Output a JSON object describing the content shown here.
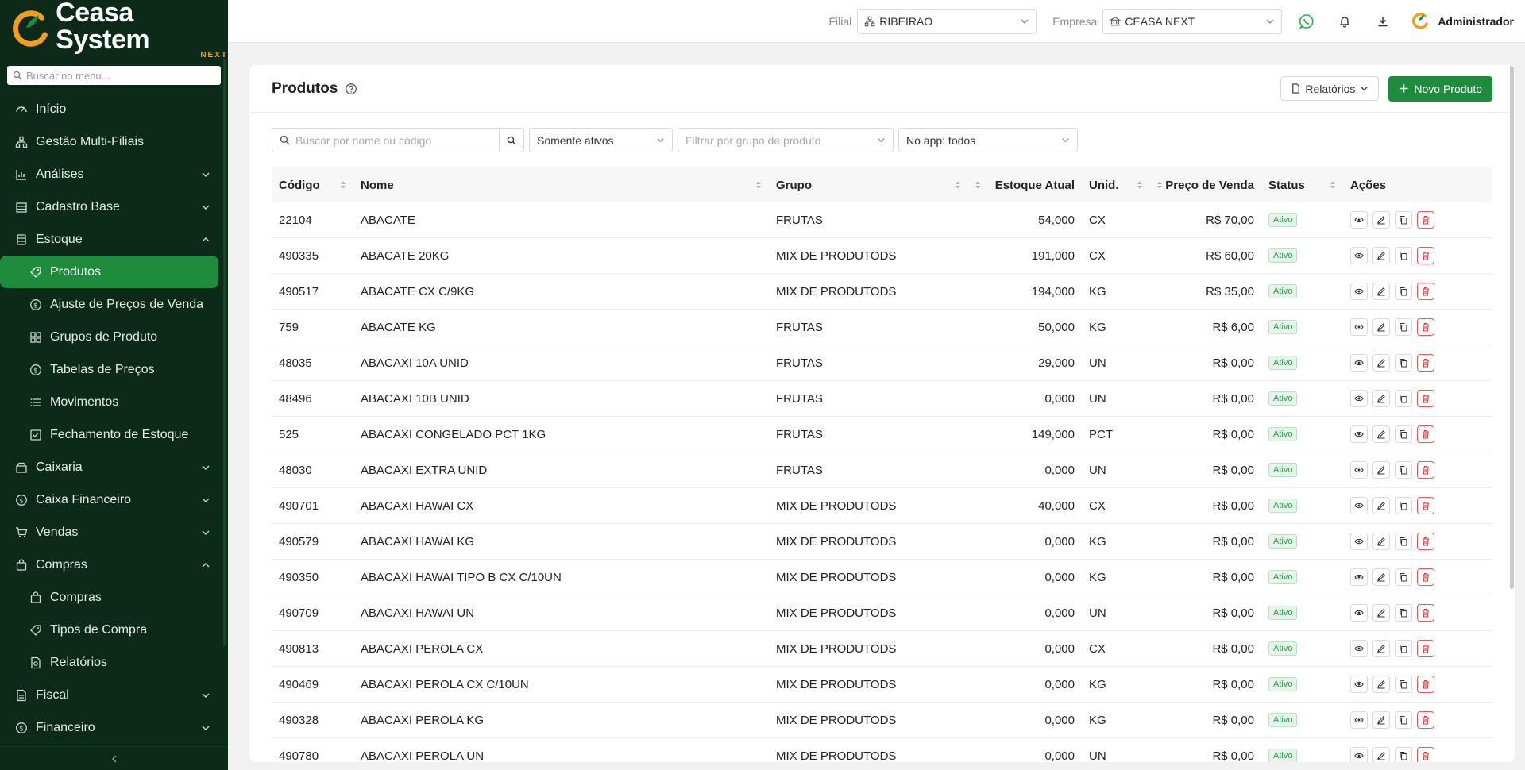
{
  "brand": {
    "name": "Ceasa System",
    "sub": "NEXT",
    "accent": "#1e8c3c",
    "orange": "#f39c1f"
  },
  "sidebar": {
    "search_placeholder": "Buscar no menu...",
    "items": [
      {
        "label": "Início",
        "icon": "dashboard-icon"
      },
      {
        "label": "Gestão Multi-Filiais",
        "icon": "network-icon"
      },
      {
        "label": "Análises",
        "icon": "chart-icon"
      },
      {
        "label": "Cadastro Base",
        "icon": "building-icon"
      },
      {
        "label": "Estoque",
        "icon": "database-icon"
      },
      {
        "label": "Produtos",
        "icon": "tag-icon"
      },
      {
        "label": "Ajuste de Preços de Venda",
        "icon": "dollar-icon"
      },
      {
        "label": "Grupos de Produto",
        "icon": "grid-icon"
      },
      {
        "label": "Tabelas de Preços",
        "icon": "dollar-icon"
      },
      {
        "label": "Movimentos",
        "icon": "list-icon"
      },
      {
        "label": "Fechamento de Estoque",
        "icon": "check-square-icon"
      },
      {
        "label": "Caixaria",
        "icon": "box-icon"
      },
      {
        "label": "Caixa Financeiro",
        "icon": "dollar-icon"
      },
      {
        "label": "Vendas",
        "icon": "cart-icon"
      },
      {
        "label": "Compras",
        "icon": "bag-icon"
      },
      {
        "label": "Compras",
        "icon": "bag-icon"
      },
      {
        "label": "Tipos de Compra",
        "icon": "tag-icon"
      },
      {
        "label": "Relatórios",
        "icon": "report-icon"
      },
      {
        "label": "Fiscal",
        "icon": "document-icon"
      },
      {
        "label": "Financeiro",
        "icon": "dollar-icon"
      }
    ]
  },
  "topbar": {
    "filial_label": "Filial",
    "filial_value": "RIBEIRAO",
    "empresa_label": "Empresa",
    "empresa_value": "CEASA NEXT",
    "user": "Administrador"
  },
  "page": {
    "title": "Produtos",
    "reports_label": "Relatórios",
    "new_label": "Novo Produto"
  },
  "filters": {
    "search_placeholder": "Buscar por nome ou código",
    "status": "Somente ativos",
    "group_placeholder": "Filtrar por grupo de produto",
    "app": "No app: todos"
  },
  "table": {
    "headers": [
      "Código",
      "Nome",
      "Grupo",
      "Estoque Atual",
      "Unid.",
      "Preço de Venda",
      "Status",
      "Ações"
    ],
    "rows": [
      [
        "22104",
        "ABACATE",
        "FRUTAS",
        "54,000",
        "CX",
        "R$ 70,00",
        "Ativo"
      ],
      [
        "490335",
        "ABACATE 20KG",
        "MIX DE PRODUTODS",
        "191,000",
        "CX",
        "R$ 60,00",
        "Ativo"
      ],
      [
        "490517",
        "ABACATE CX C/9KG",
        "MIX DE PRODUTODS",
        "194,000",
        "KG",
        "R$ 35,00",
        "Ativo"
      ],
      [
        "759",
        "ABACATE KG",
        "FRUTAS",
        "50,000",
        "KG",
        "R$ 6,00",
        "Ativo"
      ],
      [
        "48035",
        "ABACAXI 10A UNID",
        "FRUTAS",
        "29,000",
        "UN",
        "R$ 0,00",
        "Ativo"
      ],
      [
        "48496",
        "ABACAXI 10B UNID",
        "FRUTAS",
        "0,000",
        "UN",
        "R$ 0,00",
        "Ativo"
      ],
      [
        "525",
        "ABACAXI CONGELADO PCT 1KG",
        "FRUTAS",
        "149,000",
        "PCT",
        "R$ 0,00",
        "Ativo"
      ],
      [
        "48030",
        "ABACAXI EXTRA UNID",
        "FRUTAS",
        "0,000",
        "UN",
        "R$ 0,00",
        "Ativo"
      ],
      [
        "490701",
        "ABACAXI HAWAI CX",
        "MIX DE PRODUTODS",
        "40,000",
        "CX",
        "R$ 0,00",
        "Ativo"
      ],
      [
        "490579",
        "ABACAXI HAWAI KG",
        "MIX DE PRODUTODS",
        "0,000",
        "KG",
        "R$ 0,00",
        "Ativo"
      ],
      [
        "490350",
        "ABACAXI HAWAI TIPO B CX C/10UN",
        "MIX DE PRODUTODS",
        "0,000",
        "KG",
        "R$ 0,00",
        "Ativo"
      ],
      [
        "490709",
        "ABACAXI HAWAI UN",
        "MIX DE PRODUTODS",
        "0,000",
        "UN",
        "R$ 0,00",
        "Ativo"
      ],
      [
        "490813",
        "ABACAXI PEROLA CX",
        "MIX DE PRODUTODS",
        "0,000",
        "CX",
        "R$ 0,00",
        "Ativo"
      ],
      [
        "490469",
        "ABACAXI PEROLA CX C/10UN",
        "MIX DE PRODUTODS",
        "0,000",
        "KG",
        "R$ 0,00",
        "Ativo"
      ],
      [
        "490328",
        "ABACAXI PEROLA KG",
        "MIX DE PRODUTODS",
        "0,000",
        "KG",
        "R$ 0,00",
        "Ativo"
      ],
      [
        "490780",
        "ABACAXI PEROLA UN",
        "MIX DE PRODUTODS",
        "0,000",
        "UN",
        "R$ 0,00",
        "Ativo"
      ]
    ]
  }
}
